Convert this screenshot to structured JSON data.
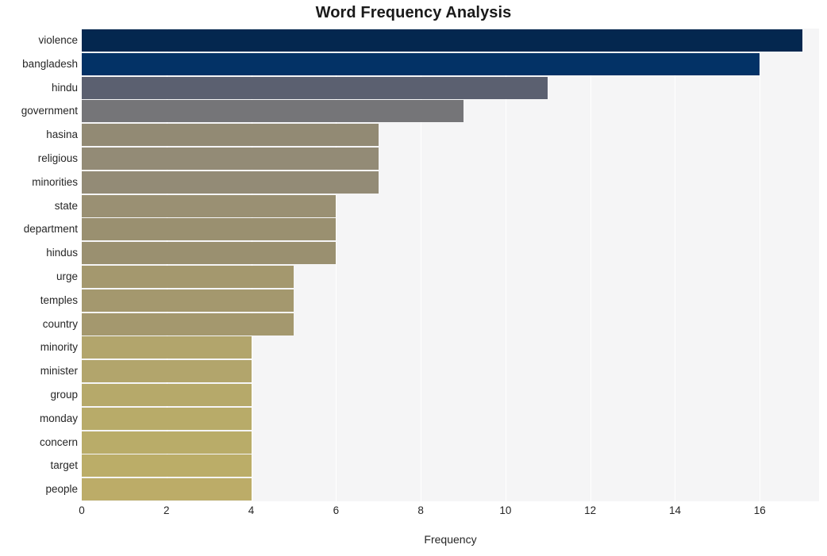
{
  "chart_data": {
    "type": "bar",
    "orientation": "horizontal",
    "title": "Word Frequency Analysis",
    "xlabel": "Frequency",
    "ylabel": "",
    "categories": [
      "violence",
      "bangladesh",
      "hindu",
      "government",
      "hasina",
      "religious",
      "minorities",
      "state",
      "department",
      "hindus",
      "urge",
      "temples",
      "country",
      "minority",
      "minister",
      "group",
      "monday",
      "concern",
      "target",
      "people"
    ],
    "values": [
      17,
      16,
      11,
      9,
      7,
      7,
      7,
      6,
      6,
      6,
      5,
      5,
      5,
      4,
      4,
      4,
      4,
      4,
      4,
      4
    ],
    "bar_colors": [
      "#04274f",
      "#033266",
      "#5b6070",
      "#757578",
      "#928a74",
      "#938b76",
      "#938b76",
      "#9a9073",
      "#9a9070",
      "#9a9070",
      "#a4986e",
      "#a4986e",
      "#a4986e",
      "#b2a56c",
      "#b2a56c",
      "#b6a96a",
      "#b8ab69",
      "#b9ac69",
      "#bbad68",
      "#bcac68"
    ],
    "xlim": [
      0,
      17.4
    ],
    "xticks": [
      0,
      2,
      4,
      6,
      8,
      10,
      12,
      14,
      16
    ],
    "xtick_labels": [
      "0",
      "2",
      "4",
      "6",
      "8",
      "10",
      "12",
      "14",
      "16"
    ],
    "grid": true,
    "grid_axis": "x",
    "grid_color": "#ffffff",
    "plot_background": "#f5f5f6",
    "figure_background": "#ffffff",
    "legend": null
  }
}
